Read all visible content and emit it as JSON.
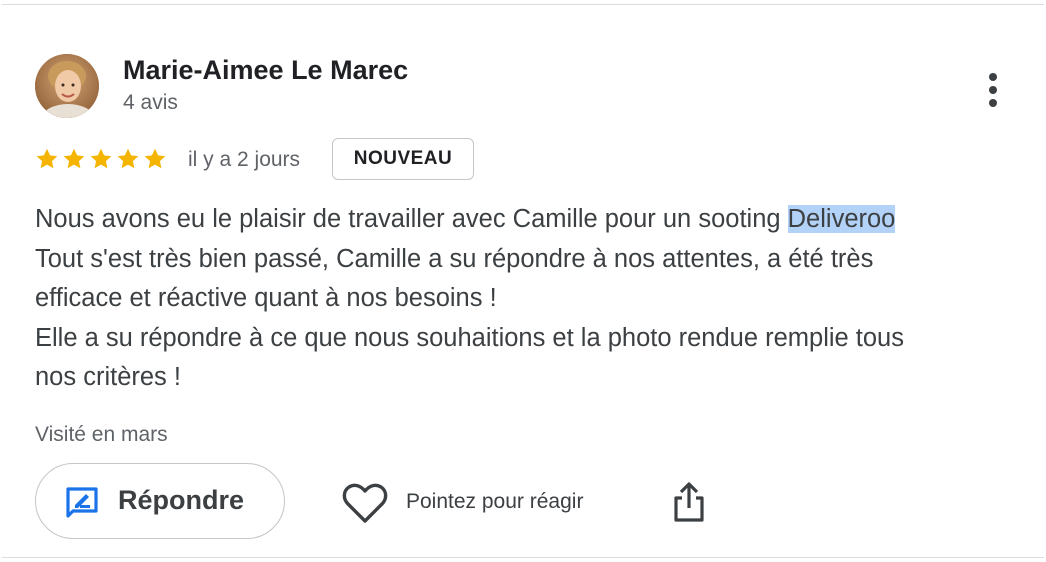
{
  "author": {
    "name": "Marie-Aimee Le Marec",
    "review_count": "4 avis"
  },
  "rating": {
    "stars": 5,
    "max_stars": 5,
    "star_color": "#f4b400"
  },
  "date": "il y a 2 jours",
  "badge": "NOUVEAU",
  "review": {
    "line1_before": "Nous avons eu le plaisir de travailler avec Camille pour un sooting ",
    "line1_highlight": "Deliveroo",
    "line2": "Tout s'est très bien passé, Camille a su répondre à nos attentes, a été très",
    "line3": "efficace et réactive quant à nos besoins !",
    "line4": "Elle a su répondre à ce que nous souhaitions et la photo rendue remplie tous",
    "line5": "nos critères !"
  },
  "visited": "Visité en mars",
  "actions": {
    "reply_label": "Répondre",
    "react_label": "Pointez pour réagir"
  },
  "colors": {
    "accent_blue": "#1a73e8",
    "highlight": "#b3d2f7"
  },
  "icons": {
    "more": "more-vertical-icon",
    "reply": "reply-edit-icon",
    "react": "heart-icon",
    "share": "share-icon"
  }
}
